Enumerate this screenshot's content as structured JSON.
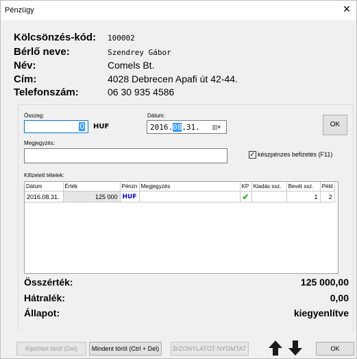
{
  "window": {
    "title": "Pénzügy"
  },
  "info": {
    "code_label": "Kölcsönzés-kód:",
    "code_value": "100002",
    "renter_label": "Bérlő neve:",
    "renter_value": "Szendrey Gábor",
    "name_label": "Név:",
    "name_value": "Comels Bt.",
    "address_label": "Cím:",
    "address_value": "4028 Debrecen Apafi út 42-44.",
    "phone_label": "Telefonszám:",
    "phone_value": "06 30 935 4586"
  },
  "form": {
    "amount_label": "Összeg:",
    "amount_value": "0",
    "currency": "HUF",
    "date_label": "Dátum:",
    "date_prefix": "2016.",
    "date_selected": "08",
    "date_suffix": ".31.",
    "ok_label": "OK",
    "note_label": "Megjegyzés:",
    "note_value": "",
    "cash_label": "készpénzes befizetés (F11)",
    "cash_checked": true
  },
  "items": {
    "label": "Kifizetett tételek:",
    "columns": [
      "Dátum",
      "Érték",
      "Pénzn",
      "Megjegyzés",
      "KP",
      "Kiadás ssz.",
      "Bevét ssz.",
      "Péld"
    ],
    "rows": [
      {
        "date": "2016.08.31.",
        "value": "125 000",
        "currency": "HUF",
        "note": "",
        "kp": true,
        "issue_no": "",
        "receipt_no": "1",
        "copies": "2"
      }
    ]
  },
  "summary": {
    "total_label": "Összérték:",
    "total_value": "125 000,00",
    "debt_label": "Hátralék:",
    "debt_value": "0,00",
    "status_label": "Állapot:",
    "status_value": "kiegyenlítve"
  },
  "footer": {
    "delete_selected": "Kijelöltet töröl (Del)",
    "delete_all": "Mindent töröl (Ctrl + Del)",
    "print_receipt": "BIZONYLATOT NYOMTAT",
    "ok_label": "OK"
  }
}
